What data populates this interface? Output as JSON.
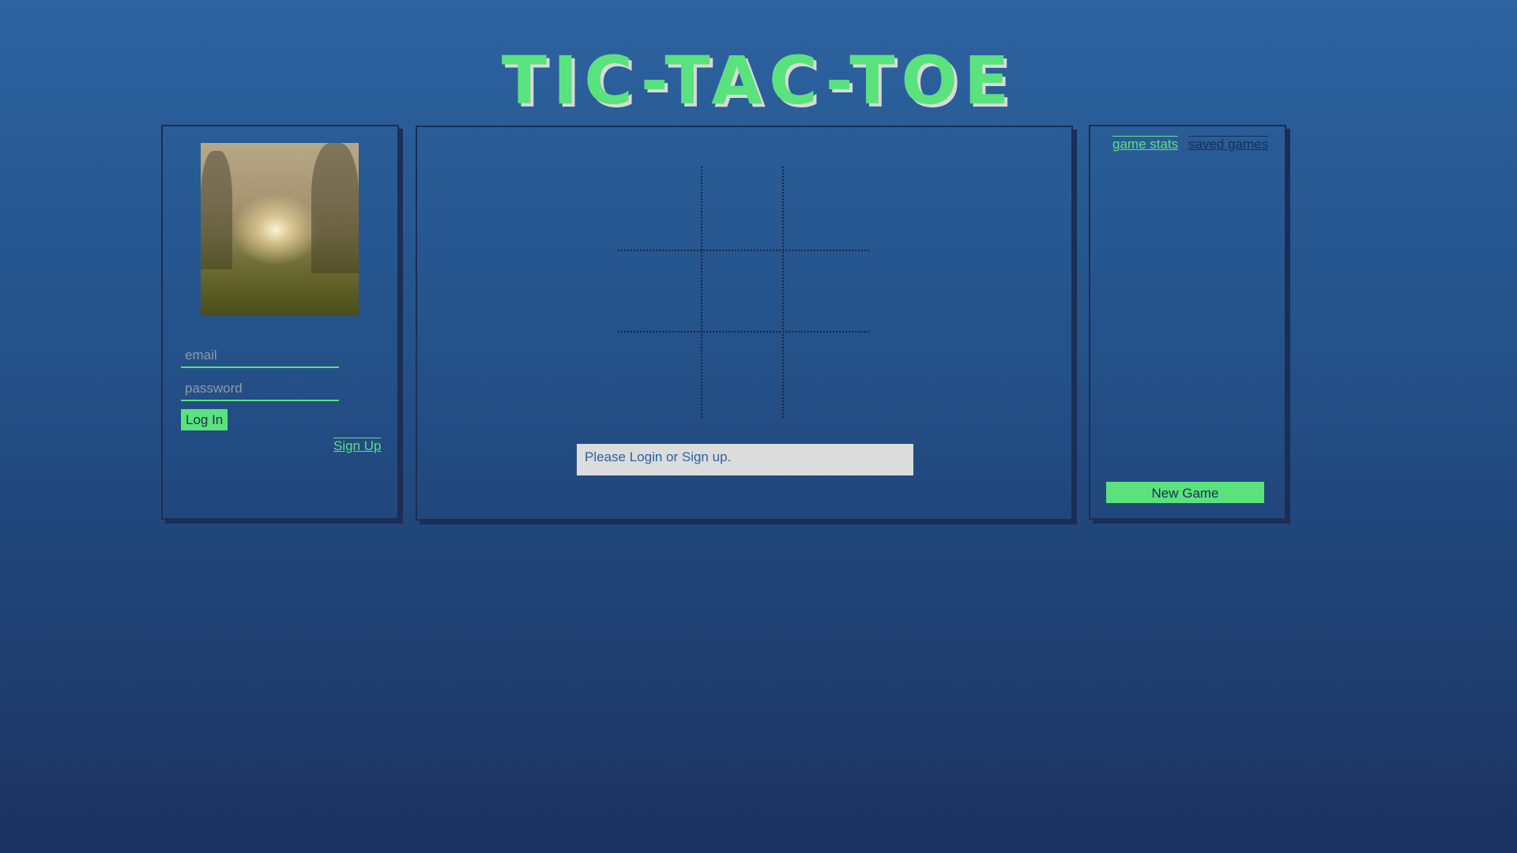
{
  "header": {
    "title": "TIC-TAC-TOE"
  },
  "login_panel": {
    "email_placeholder": "email",
    "password_placeholder": "password",
    "login_label": "Log In",
    "signup_label": "Sign Up"
  },
  "game": {
    "board": [
      "",
      "",
      "",
      "",
      "",
      "",
      "",
      "",
      ""
    ],
    "message": "Please Login or Sign up."
  },
  "side_panel": {
    "tabs": [
      {
        "label": "game stats",
        "active": true
      },
      {
        "label": "saved games",
        "active": false
      }
    ],
    "new_game_label": "New Game"
  },
  "colors": {
    "accent": "#5ae27d",
    "panel_border": "#1b2e55",
    "background_top": "#2d63a0",
    "background_bottom": "#1c3260",
    "message_bg": "#dcdcdc"
  }
}
